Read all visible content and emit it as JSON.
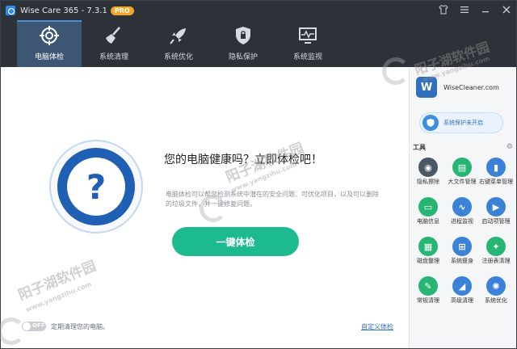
{
  "window": {
    "title": "Wise Care 365 - 7.3.1",
    "badge": "PRO",
    "controls": [
      "shirt-icon",
      "menu-icon",
      "minimize-icon",
      "close-icon"
    ]
  },
  "nav": {
    "tabs": [
      {
        "label": "电脑体检",
        "icon": "crosshair-icon",
        "active": true
      },
      {
        "label": "系统清理",
        "icon": "broom-icon",
        "active": false
      },
      {
        "label": "系统优化",
        "icon": "rocket-icon",
        "active": false
      },
      {
        "label": "隐私保护",
        "icon": "shield-lock-icon",
        "active": false
      },
      {
        "label": "系统监视",
        "icon": "monitor-icon",
        "active": false
      }
    ]
  },
  "main": {
    "question_mark": "?",
    "headline": "您的电脑健康吗？立即体检吧！",
    "description": "电脑体检可以帮您检测系统中潜在的安全问题、可优化项目，以及可以删除的垃圾文件，并一键修复问题。",
    "check_button": "一键体检",
    "toggle_label": "OFF",
    "footer_text": "定期清理您的电脑。",
    "custom_link": "自定义体检"
  },
  "side": {
    "brand_logo": "W",
    "brand_name": "WiseCleaner.com",
    "protect_status": "系统保护未开启",
    "tools_title": "工具",
    "tools": [
      {
        "label": "隐私擦除",
        "icon": "eye-slash-icon",
        "color": "#4a5866",
        "glyph": "◉"
      },
      {
        "label": "大文件管理",
        "icon": "file-icon",
        "color": "#27b573",
        "glyph": "▤"
      },
      {
        "label": "右键菜单管理",
        "icon": "mouse-icon",
        "color": "#3b82d6",
        "glyph": "▮"
      },
      {
        "label": "电脑信息",
        "icon": "info-icon",
        "color": "#27b573",
        "glyph": "▭"
      },
      {
        "label": "进程监视",
        "icon": "process-icon",
        "color": "#3b82d6",
        "glyph": "∿"
      },
      {
        "label": "启动项管理",
        "icon": "startup-icon",
        "color": "#3b82d6",
        "glyph": "▶"
      },
      {
        "label": "磁盘整理",
        "icon": "disk-icon",
        "color": "#27b573",
        "glyph": "▦"
      },
      {
        "label": "系统瘦身",
        "icon": "windows-icon",
        "color": "#3b82d6",
        "glyph": "⊞"
      },
      {
        "label": "注册表清理",
        "icon": "registry-icon",
        "color": "#27b573",
        "glyph": "✦"
      },
      {
        "label": "常规清理",
        "icon": "brush-icon",
        "color": "#27b573",
        "glyph": "✎"
      },
      {
        "label": "高级清理",
        "icon": "eraser-icon",
        "color": "#3b82d6",
        "glyph": "◢"
      },
      {
        "label": "系统优化",
        "icon": "optimize-icon",
        "color": "#3b82d6",
        "glyph": "✺"
      }
    ]
  },
  "watermark": {
    "cn": "阳子湖软件园",
    "url": "www.yangzihu.com"
  }
}
